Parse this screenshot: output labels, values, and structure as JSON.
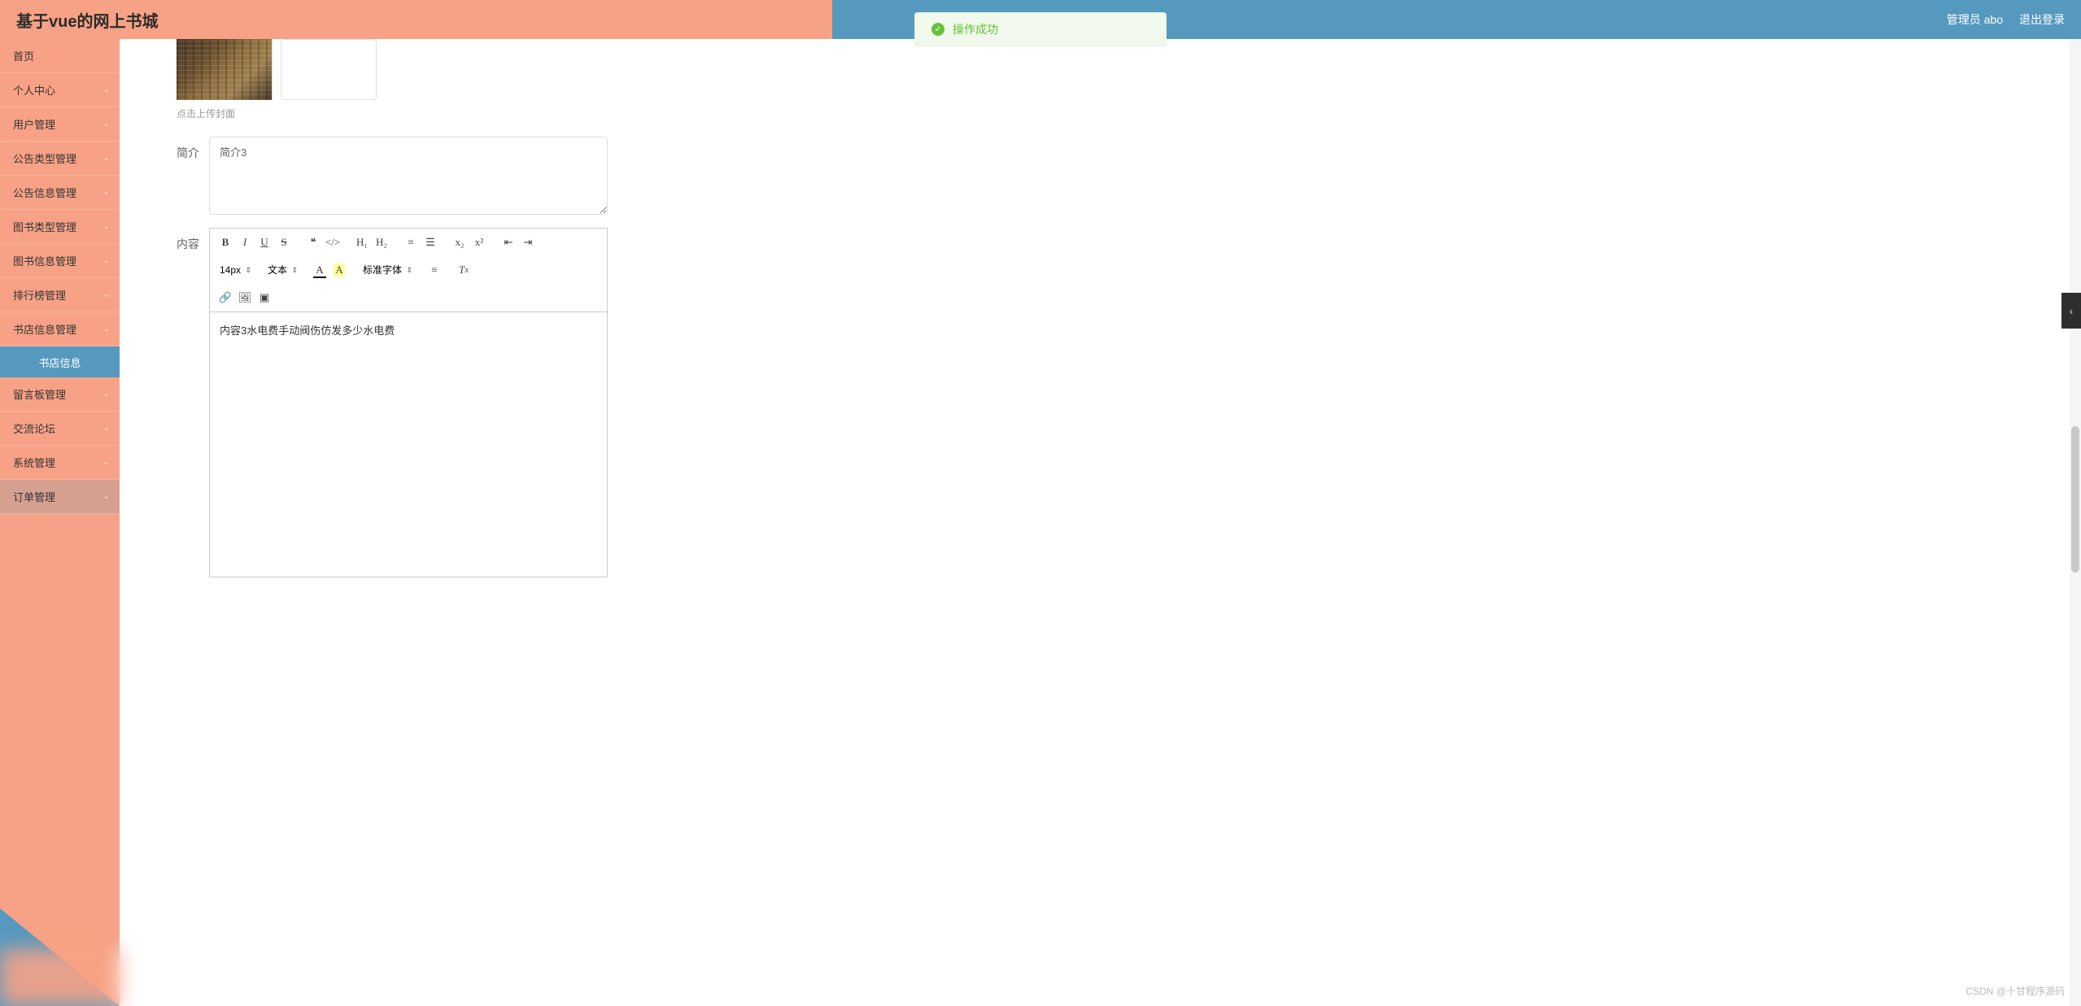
{
  "header": {
    "title": "基于vue的网上书城",
    "user_label": "管理员 abo",
    "logout": "退出登录"
  },
  "toast": {
    "text": "操作成功"
  },
  "sidebar": {
    "items": [
      {
        "label": "首页",
        "expandable": false
      },
      {
        "label": "个人中心",
        "expandable": true
      },
      {
        "label": "用户管理",
        "expandable": true
      },
      {
        "label": "公告类型管理",
        "expandable": true
      },
      {
        "label": "公告信息管理",
        "expandable": true
      },
      {
        "label": "图书类型管理",
        "expandable": true
      },
      {
        "label": "图书信息管理",
        "expandable": true
      },
      {
        "label": "排行榜管理",
        "expandable": true
      },
      {
        "label": "书店信息管理",
        "expandable": true
      },
      {
        "label": "留言板管理",
        "expandable": true
      },
      {
        "label": "交流论坛",
        "expandable": true
      },
      {
        "label": "系统管理",
        "expandable": true
      },
      {
        "label": "订单管理",
        "expandable": true
      }
    ],
    "active_sub": "书店信息"
  },
  "form": {
    "upload_hint": "点击上传封面",
    "intro_label": "简介",
    "intro_value": "简介3",
    "content_label": "内容",
    "editor_text": "内容3水电费手动阀伤仿发多少水电费"
  },
  "editor_toolbar": {
    "font_size": "14px",
    "text_type": "文本",
    "font_family": "标准字体"
  },
  "watermark": "CSDN @十甘程序源码"
}
